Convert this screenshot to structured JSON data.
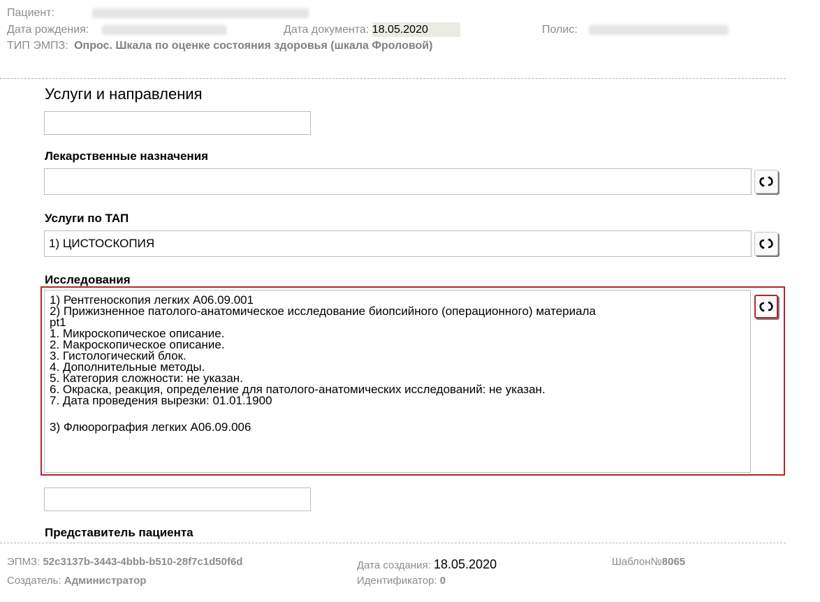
{
  "header": {
    "patient_label": "Пациент:",
    "birth_label": "Дата рождения:",
    "doc_date_label": "Дата документа:",
    "doc_date_value": "18.05.2020",
    "policy_label": "Полис:",
    "type_label": "ТИП ЭМПЗ:",
    "type_value": "Опрос. Шкала по оценке состояния здоровья (шкала Фроловой)"
  },
  "sections": {
    "services_title": "Услуги и направления",
    "drug_label": "Лекарственные назначения",
    "tap_label": "Услуги по ТАП",
    "tap_value": "1) ЦИСТОСКОПИЯ",
    "research_label": "Исследования",
    "research_lines": [
      "1) Рентгеноскопия легких A06.09.001",
      "2) Прижизненное патолого-анатомическое исследование биопсийного (операционного) материала",
      "pt1",
      "1. Микроскопическое описание.",
      "2. Макроскопическое описание.",
      "3. Гистологический блок.",
      "4. Дополнительные методы.",
      "5. Категория сложности: не указан.",
      "6. Окраска, реакция, определение для патолого-анатомических исследований: не указан.",
      "7. Дата проведения вырезки: 01.01.1900",
      "",
      "3) Флюорография легких A06.09.006"
    ],
    "representative_label": "Представитель пациента"
  },
  "footer": {
    "epmz_label": "ЭПМЗ:",
    "epmz_value": "52c3137b-3443-4bbb-b510-28f7c1d50f6d",
    "creator_label": "Создатель:",
    "creator_value": "Администратор",
    "created_label": "Дата создания:",
    "created_value": "18.05.2020",
    "identifier_label": "Идентификатор:",
    "identifier_value": "0",
    "template_label": "Шаблон№",
    "template_value": "8065"
  },
  "icons": {
    "refresh": "refresh-icon"
  },
  "colors": {
    "highlight": "#b3262a",
    "muted_text": "#8c8c8c",
    "date_field_bg": "#ebebe4"
  }
}
